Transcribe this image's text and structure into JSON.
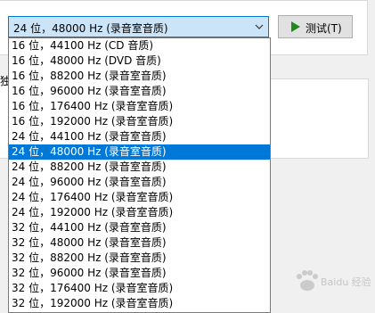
{
  "combo": {
    "value": "24 位，48000 Hz (录音室音质)"
  },
  "test_button": {
    "label": "测试(T)"
  },
  "cut_label": "独",
  "dropdown": {
    "selected_index": 7,
    "options": [
      "16 位，44100 Hz (CD 音质)",
      "16 位，48000 Hz (DVD 音质)",
      "16 位，88200 Hz (录音室音质)",
      "16 位，96000 Hz (录音室音质)",
      "16 位，176400 Hz (录音室音质)",
      "16 位，192000 Hz (录音室音质)",
      "24 位，44100 Hz (录音室音质)",
      "24 位，48000 Hz (录音室音质)",
      "24 位，88200 Hz (录音室音质)",
      "24 位，96000 Hz (录音室音质)",
      "24 位，176400 Hz (录音室音质)",
      "24 位，192000 Hz (录音室音质)",
      "32 位，44100 Hz (录音室音质)",
      "32 位，48000 Hz (录音室音质)",
      "32 位，88200 Hz (录音室音质)",
      "32 位，96000 Hz (录音室音质)",
      "32 位，176400 Hz (录音室音质)",
      "32 位，192000 Hz (录音室音质)"
    ]
  },
  "watermark": {
    "text": "Baidu 经验",
    "icon": "baidu-paw-logo"
  },
  "colors": {
    "selection": "#0078d7",
    "combo_focus_bg": "#cce4f7",
    "play_green": "#1e8a1e"
  }
}
